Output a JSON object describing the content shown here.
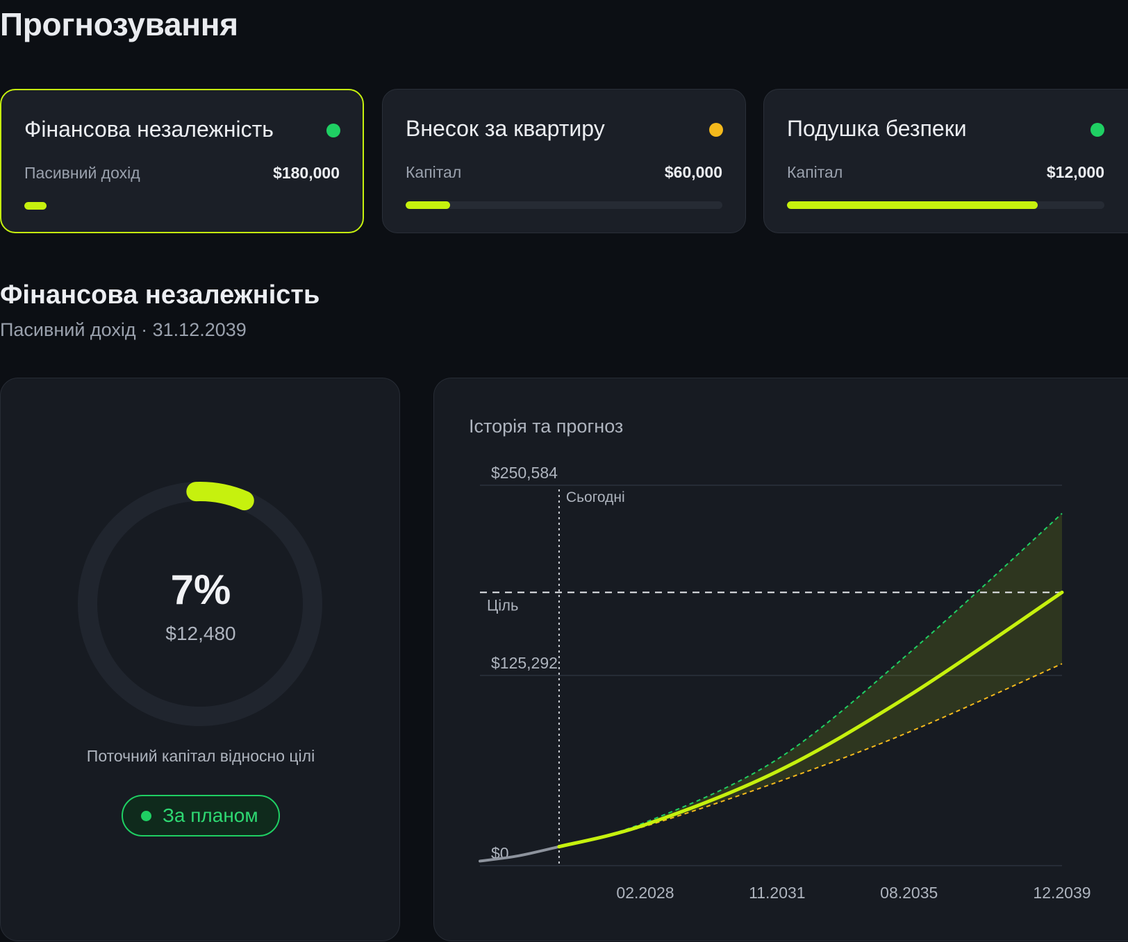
{
  "page": {
    "title": "Прогнозування"
  },
  "goals": [
    {
      "title": "Фінансова незалежність",
      "label": "Пасивний дохід",
      "value": "$180,000",
      "progress": 0.07,
      "status_color": "#1fcf63",
      "active": true
    },
    {
      "title": "Внесок за квартиру",
      "label": "Капітал",
      "value": "$60,000",
      "progress": 0.14,
      "status_color": "#f4b91c",
      "active": false
    },
    {
      "title": "Подушка безпеки",
      "label": "Капітал",
      "value": "$12,000",
      "progress": 0.79,
      "status_color": "#1fcf63",
      "active": false
    }
  ],
  "section": {
    "title": "Фінансова незалежність",
    "subtitle": "Пасивний дохід · 31.12.2039"
  },
  "progress_panel": {
    "percent_label": "7%",
    "progress": 0.07,
    "amount": "$12,480",
    "caption": "Поточний капітал відносно цілі",
    "status": "За планом"
  },
  "chart": {
    "title": "Історія та прогноз",
    "today_label": "Сьогодні",
    "goal_label": "Ціль"
  },
  "chart_data": {
    "type": "line",
    "title": "Історія та прогноз",
    "y_ticks": [
      "$0",
      "$125,292",
      "$250,584"
    ],
    "y_tick_values": [
      0,
      125292,
      250584
    ],
    "ylim": [
      0,
      250584
    ],
    "x_ticks": [
      "02.2028",
      "11.2031",
      "08.2035",
      "12.2039"
    ],
    "x_tick_values": [
      2028.1,
      2031.85,
      2035.6,
      2039.95
    ],
    "xlim": [
      2023.4,
      2039.95
    ],
    "today_x": 2025.65,
    "goal_y": 180000,
    "grid": true,
    "legend": "none",
    "colors": {
      "history": "#8d939d",
      "forecast": "#c6f10e",
      "upper": "#1fcf63",
      "lower": "#f4b91c"
    },
    "series": [
      {
        "role": "history",
        "x": [
          2023.4,
          2024.5,
          2025.65
        ],
        "values": [
          3000,
          6500,
          12480
        ]
      },
      {
        "role": "forecast",
        "x": [
          2025.65,
          2028.1,
          2031.85,
          2035.6,
          2039.95
        ],
        "values": [
          12480,
          27000,
          62000,
          112000,
          180000
        ]
      },
      {
        "role": "upper",
        "x": [
          2025.65,
          2028.1,
          2031.85,
          2035.6,
          2039.95
        ],
        "values": [
          12480,
          28500,
          70000,
          140000,
          232000
        ]
      },
      {
        "role": "lower",
        "x": [
          2025.65,
          2028.1,
          2031.85,
          2035.6,
          2039.95
        ],
        "values": [
          12480,
          26000,
          55000,
          88000,
          133000
        ]
      }
    ]
  }
}
